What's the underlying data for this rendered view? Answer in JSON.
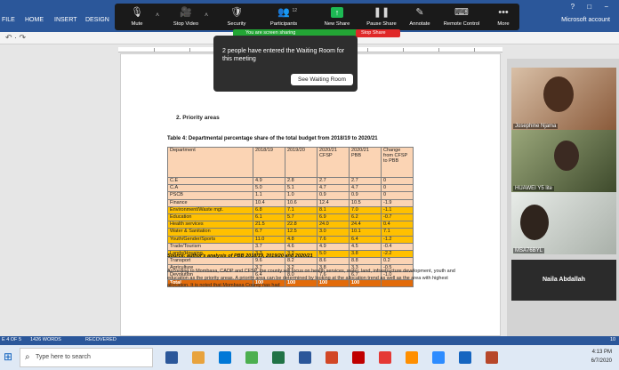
{
  "word": {
    "tabs": [
      "FILE",
      "HOME",
      "INSERT",
      "DESIGN"
    ],
    "account": "Microsoft account",
    "window_controls": "? □ −",
    "undo_bar": "↶ · ↷"
  },
  "zoom": {
    "toolbar": [
      {
        "icon": "microphone-icon",
        "glyph": "🎙",
        "label": "Mute"
      },
      {
        "icon": "camera-icon",
        "glyph": "🎥",
        "label": "Stop Video"
      },
      {
        "icon": "shield-icon",
        "glyph": "🛡",
        "label": "Security"
      },
      {
        "icon": "participants-icon",
        "glyph": "👥",
        "label": "Participants",
        "badge": "12"
      },
      {
        "icon": "new-share-icon",
        "glyph": "↑",
        "label": "New Share"
      },
      {
        "icon": "pause-icon",
        "glyph": "❚❚",
        "label": "Pause Share"
      },
      {
        "icon": "annotate-icon",
        "glyph": "✎",
        "label": "Annotate"
      },
      {
        "icon": "remote-control-icon",
        "glyph": "⌨",
        "label": "Remote Control"
      },
      {
        "icon": "more-icon",
        "glyph": "•••",
        "label": "More"
      }
    ],
    "sharing_text": "You are screen sharing",
    "stop_share": "Stop Share",
    "waiting_room": {
      "message": "2 people have entered the Waiting Room for this meeting",
      "button": "See Waiting Room"
    },
    "participants": [
      {
        "name": "Josephine Njama",
        "bg": "#b58a6a"
      },
      {
        "name": "HUAWEI Y5 lite",
        "bg": "#5f7346"
      },
      {
        "name": "MSA76BYL",
        "bg": "#c7cdc7"
      }
    ],
    "active_speaker": "Naila Abdallah"
  },
  "document": {
    "heading": "2.   Priority areas",
    "caption": "Table 4: Departmental percentage share of the total budget from 2018/19 to 2020/21",
    "table_headers": [
      "Department",
      "2018/19",
      "2019/20",
      "2020/21 CFSP",
      "2020/21 PBB",
      "Change from CFSP to PBB"
    ],
    "rows": [
      {
        "cells": [
          "C.E",
          "4.9",
          "2.8",
          "2.7",
          "2.7",
          "0"
        ],
        "style": "peach"
      },
      {
        "cells": [
          "C.A",
          "5.0",
          "5.1",
          "4.7",
          "4.7",
          "0"
        ],
        "style": "peach"
      },
      {
        "cells": [
          "PSCB",
          "1.1",
          "1.0",
          "0.9",
          "0.9",
          "0"
        ],
        "style": "peach"
      },
      {
        "cells": [
          "Finance",
          "10.4",
          "10.6",
          "12.4",
          "10.5",
          "-1.9"
        ],
        "style": "peach"
      },
      {
        "cells": [
          "Environment/Waste mgt.",
          "6.8",
          "7.1",
          "8.1",
          "7.0",
          "-1.1"
        ],
        "style": "yellow"
      },
      {
        "cells": [
          "Education",
          "6.1",
          "5.7",
          "6.9",
          "6.2",
          "-0.7"
        ],
        "style": "yellow"
      },
      {
        "cells": [
          "Health services",
          "21.5",
          "22.8",
          "24.0",
          "24.4",
          "0.4"
        ],
        "style": "yellow"
      },
      {
        "cells": [
          "Water & Sanitation",
          "6.7",
          "12.5",
          "3.0",
          "10.1",
          "7.1"
        ],
        "style": "yellow"
      },
      {
        "cells": [
          "Youth/Gender/Sports",
          "11.0",
          "4.8",
          "7.6",
          "6.4",
          "-1.2"
        ],
        "style": "yellow"
      },
      {
        "cells": [
          "Trade/Tourism",
          "3.7",
          "4.6",
          "4.9",
          "4.5",
          "-0.4"
        ],
        "style": "peach"
      },
      {
        "cells": [
          "Lands/Housing",
          "3.3",
          "3.2",
          "5.0",
          "3.8",
          "-2.2"
        ],
        "style": "yellow"
      },
      {
        "cells": [
          "Transport",
          "9.6",
          "8.2",
          "8.6",
          "8.8",
          "0.2"
        ],
        "style": "peach"
      },
      {
        "cells": [
          "Agriculture",
          "3.7",
          "3.2",
          "3.8",
          "3.3",
          "-0.5"
        ],
        "style": "peach"
      },
      {
        "cells": [
          "Devolution",
          "6.4",
          "8.0",
          "7.6",
          "6.7",
          "-1.0"
        ],
        "style": "peach"
      },
      {
        "cells": [
          "Total",
          "100",
          "100",
          "100",
          "100",
          ""
        ],
        "style": "total"
      }
    ],
    "source": "Source: author's analysis of PBB 2018/19, 2019/20 and 2020/21",
    "paragraph": "According to Mombasa, CADP and CFSP, the county will focus on health services, water, land, infrastructure development, youth and education as the priority areas. A priority area can be determined by looking at the allocation trend as well as the area with highest allocation. It is noted that Mombasa County has had"
  },
  "status_bar": {
    "page": "E 4 OF 5",
    "words": "1426 WORDS",
    "recovered": "RECOVERED",
    "zoom": "10"
  },
  "taskbar": {
    "search_placeholder": "Type here to search",
    "time": "4:13 PM",
    "date": "6/7/2020",
    "colors": [
      "#2b579a",
      "#e8a33d",
      "#0078d7",
      "#4caf50",
      "#217346",
      "#2b579a",
      "#d24726",
      "#c00000",
      "#e53935",
      "#ff8f00",
      "#2d8cff",
      "#1565c0",
      "#b7472a"
    ]
  }
}
